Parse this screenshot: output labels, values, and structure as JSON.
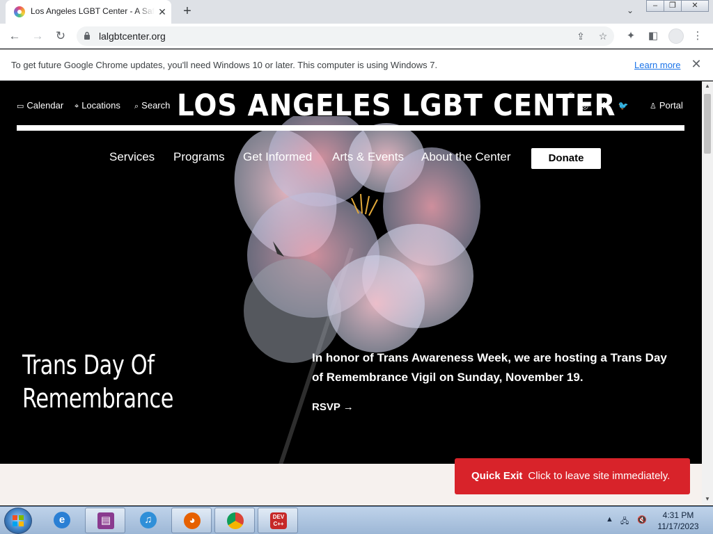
{
  "browser": {
    "tab": {
      "title": "Los Angeles LGBT Center - A Safe"
    },
    "url": "lalgbtcenter.org",
    "infobar": {
      "message": "To get future Google Chrome updates, you'll need Windows 10 or later. This computer is using Windows 7.",
      "link": "Learn more"
    }
  },
  "site": {
    "utility_nav": [
      "Calendar",
      "Locations",
      "Search"
    ],
    "logo": "LOS ANGELES LGBT CENTER",
    "logo_mark": "®",
    "portal": "Portal",
    "social": [
      "instagram-icon",
      "facebook-icon",
      "twitter-icon"
    ],
    "main_nav": [
      "Services",
      "Programs",
      "Get Informed",
      "Arts & Events",
      "About the Center"
    ],
    "donate": "Donate",
    "hero": {
      "title": "Trans Day Of Remembrance",
      "description": "In honor of Trans Awareness Week, we are hosting a Trans Day of Remembrance Vigil on Sunday, November 19.",
      "cta": "RSVP"
    },
    "quick_exit": {
      "label": "Quick Exit",
      "text": "Click to leave site immediately."
    }
  },
  "taskbar": {
    "apps": [
      "internet-explorer",
      "winrar",
      "itunes",
      "firefox",
      "chrome",
      "dev-c++"
    ],
    "time": "4:31 PM",
    "date": "11/17/2023"
  },
  "colors": {
    "quick_exit": "#d8232a",
    "link": "#1a73e8"
  }
}
